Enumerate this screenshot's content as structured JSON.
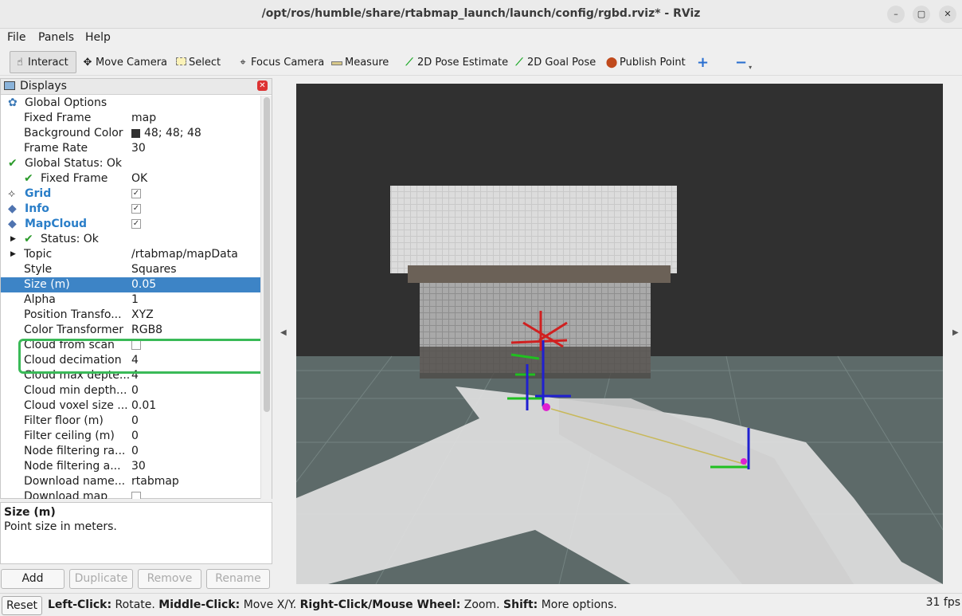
{
  "window": {
    "title": "/opt/ros/humble/share/rtabmap_launch/launch/config/rgbd.rviz* - RViz",
    "minimize": "–",
    "maximize": "▢",
    "close": "✕"
  },
  "menu": [
    "File",
    "Panels",
    "Help"
  ],
  "toolbar": [
    {
      "label": "Interact",
      "icon": "hand-cursor-icon"
    },
    {
      "label": "Move Camera",
      "icon": "move-camera-icon"
    },
    {
      "label": "Select",
      "icon": "select-box-icon"
    },
    {
      "label": "Focus Camera",
      "icon": "crosshair-icon"
    },
    {
      "label": "Measure",
      "icon": "ruler-icon"
    },
    {
      "label": "2D Pose Estimate",
      "icon": "green-arrow-icon"
    },
    {
      "label": "2D Goal Pose",
      "icon": "green-arrow-icon"
    },
    {
      "label": "Publish Point",
      "icon": "map-pin-icon"
    }
  ],
  "displays": {
    "title": "Displays",
    "rows": [
      {
        "key": "Global Options",
        "value": ""
      },
      {
        "key": "Fixed Frame",
        "value": "map"
      },
      {
        "key": "Background Color",
        "value": "48; 48; 48"
      },
      {
        "key": "Frame Rate",
        "value": "30"
      },
      {
        "key": "Global Status: Ok",
        "value": ""
      },
      {
        "key": "Fixed Frame",
        "value": "OK"
      },
      {
        "key": "Grid",
        "value": ""
      },
      {
        "key": "Info",
        "value": ""
      },
      {
        "key": "MapCloud",
        "value": ""
      },
      {
        "key": "Status: Ok",
        "value": ""
      },
      {
        "key": "Topic",
        "value": "/rtabmap/mapData"
      },
      {
        "key": "Style",
        "value": "Squares"
      },
      {
        "key": "Size (m)",
        "value": "0.05"
      },
      {
        "key": "Alpha",
        "value": "1"
      },
      {
        "key": "Position Transfo...",
        "value": "XYZ"
      },
      {
        "key": "Color Transformer",
        "value": "RGB8"
      },
      {
        "key": "Cloud from scan",
        "value": ""
      },
      {
        "key": "Cloud decimation",
        "value": "4"
      },
      {
        "key": "Cloud max depte...",
        "value": "4"
      },
      {
        "key": "Cloud min depth...",
        "value": "0"
      },
      {
        "key": "Cloud voxel size ...",
        "value": "0.01"
      },
      {
        "key": "Filter floor (m)",
        "value": "0"
      },
      {
        "key": "Filter ceiling (m)",
        "value": "0"
      },
      {
        "key": "Node filtering ra...",
        "value": "0"
      },
      {
        "key": "Node filtering a...",
        "value": "30"
      },
      {
        "key": "Download name...",
        "value": "rtabmap"
      },
      {
        "key": "Download map",
        "value": ""
      }
    ]
  },
  "description": {
    "title": "Size (m)",
    "text": "Point size in meters."
  },
  "buttons": {
    "add": "Add",
    "duplicate": "Duplicate",
    "remove": "Remove",
    "rename": "Rename"
  },
  "status": {
    "reset": "Reset",
    "help": [
      {
        "b": "Left-Click:",
        "t": " Rotate. "
      },
      {
        "b": "Middle-Click:",
        "t": " Move X/Y. "
      },
      {
        "b": "Right-Click/Mouse Wheel:",
        "t": " Zoom. "
      },
      {
        "b": "Shift:",
        "t": " More options."
      }
    ],
    "fps": "31 fps"
  },
  "colors": {
    "background": "#303030",
    "selection": "#3d84c6",
    "highlight": "#3aba58"
  }
}
